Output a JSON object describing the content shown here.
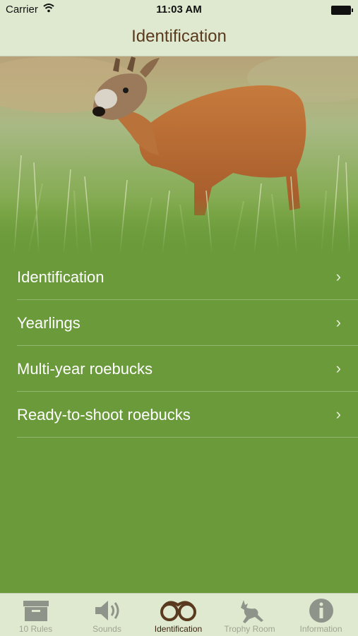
{
  "status_bar": {
    "carrier": "Carrier",
    "time": "11:03 AM"
  },
  "nav": {
    "title": "Identification"
  },
  "menu": {
    "items": [
      {
        "label": "Identification",
        "chevron": "›"
      },
      {
        "label": "Yearlings",
        "chevron": "›"
      },
      {
        "label": "Multi-year roebucks",
        "chevron": "›"
      },
      {
        "label": "Ready-to-shoot roebucks",
        "chevron": "›"
      }
    ]
  },
  "tab_bar": {
    "items": [
      {
        "label": "10 Rules",
        "icon": "archive-box-icon"
      },
      {
        "label": "Sounds",
        "icon": "speaker-icon"
      },
      {
        "label": "Identification",
        "icon": "binoculars-icon",
        "active": true
      },
      {
        "label": "Trophy Room",
        "icon": "leaping-deer-icon"
      },
      {
        "label": "Information",
        "icon": "info-icon"
      }
    ]
  },
  "colors": {
    "bar_background": "#dfe9cf",
    "list_background": "#6a9a3a",
    "title_brown": "#5a3a1e",
    "tab_inactive": "#9ea493",
    "tab_active": "#3b2410"
  }
}
